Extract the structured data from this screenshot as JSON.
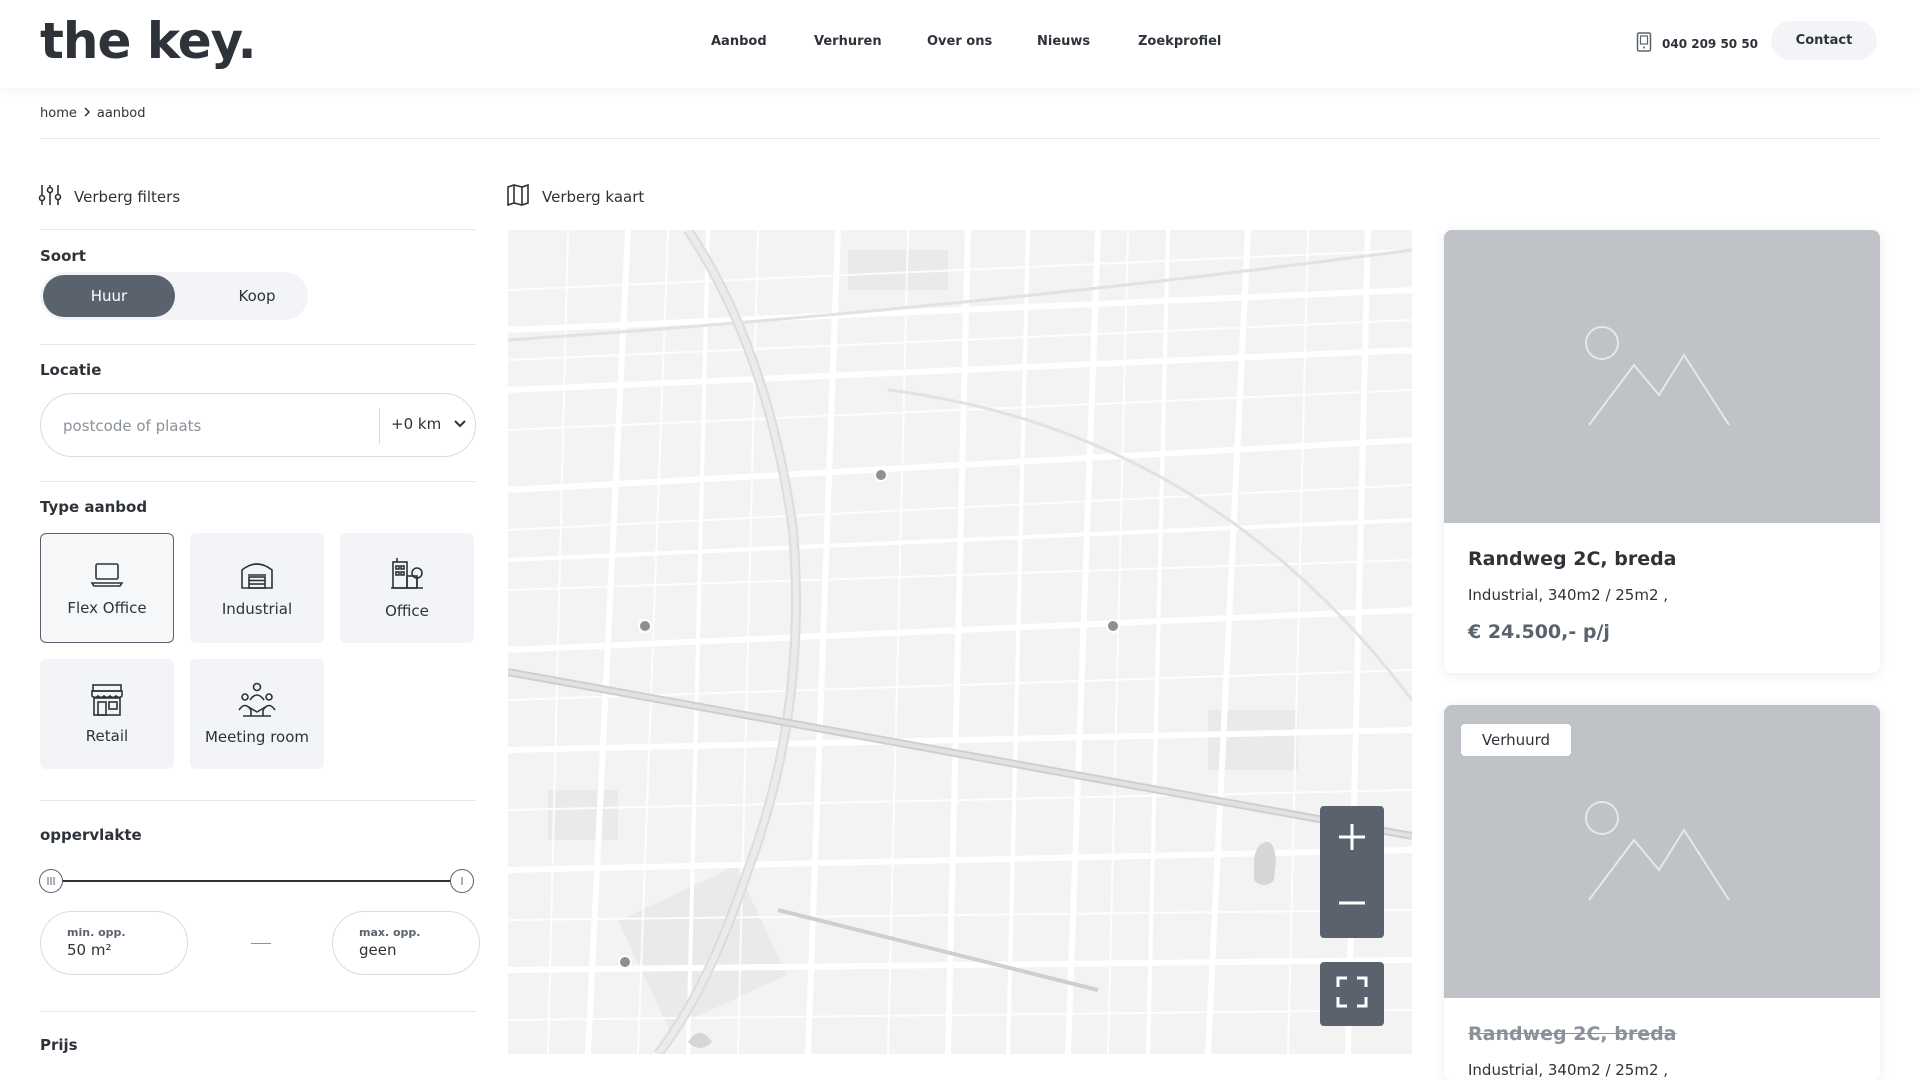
{
  "header": {
    "logo": "the key.",
    "nav": [
      "Aanbod",
      "Verhuren",
      "Over ons",
      "Nieuws",
      "Zoekprofiel"
    ],
    "phone": "040 209 50 50",
    "contact_label": "Contact"
  },
  "breadcrumb": {
    "home": "home",
    "current": "aanbod"
  },
  "filters": {
    "toggle_label": "Verberg filters",
    "soort": {
      "label": "Soort",
      "options": [
        "Huur",
        "Koop"
      ],
      "selected": "Huur"
    },
    "locatie": {
      "label": "Locatie",
      "placeholder": "postcode of plaats",
      "radius": "+0 km"
    },
    "type_aanbod": {
      "label": "Type aanbod",
      "items": [
        {
          "label": "Flex Office",
          "icon": "laptop-icon",
          "selected": true
        },
        {
          "label": "Industrial",
          "icon": "warehouse-icon",
          "selected": false
        },
        {
          "label": "Office",
          "icon": "office-building-icon",
          "selected": false
        },
        {
          "label": "Retail",
          "icon": "shop-icon",
          "selected": false
        },
        {
          "label": "Meeting room",
          "icon": "meeting-room-icon",
          "selected": false
        }
      ]
    },
    "oppervlakte": {
      "label": "oppervlakte",
      "min_label": "min. opp.",
      "min_value": "50 m²",
      "max_label": "max. opp.",
      "max_value": "geen"
    },
    "prijs": {
      "label": "Prijs"
    }
  },
  "map": {
    "toggle_label": "Verberg kaart",
    "controls": [
      "zoom-in",
      "zoom-out",
      "fullscreen"
    ]
  },
  "listings": [
    {
      "title": "Randweg 2C, breda",
      "details": "Industrial, 340m2 / 25m2 ,",
      "price": "€ 24.500,- p/j",
      "badge": ""
    },
    {
      "title": "Randweg 2C, breda",
      "details": "Industrial, 340m2 / 25m2 ,",
      "price": "",
      "badge": "Verhuurd"
    }
  ],
  "colors": {
    "primary": "#5a636d",
    "text": "#2d3339",
    "light_bg": "#f2f4f7",
    "placeholder_image": "#bfc3c7",
    "map_bg": "#f4f4f4"
  }
}
